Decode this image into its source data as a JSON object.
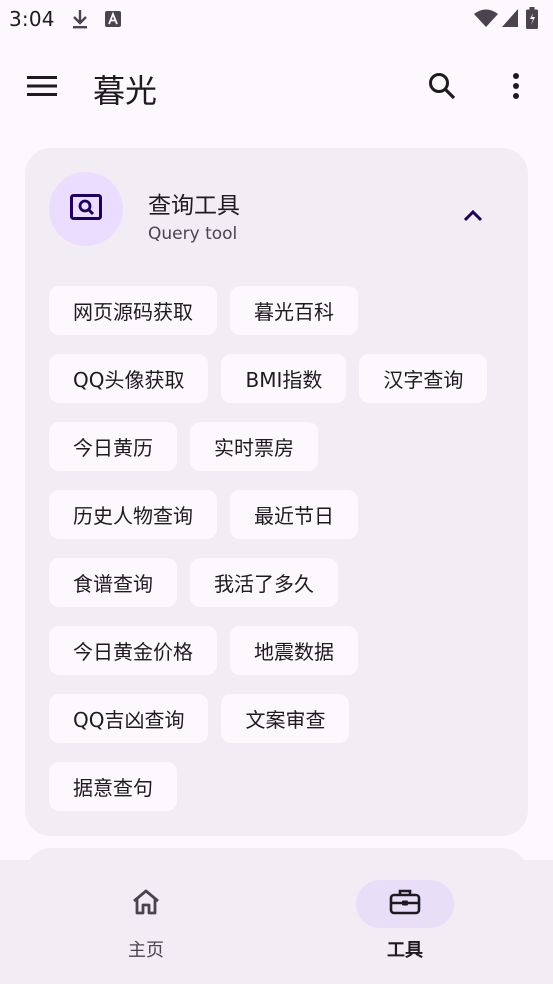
{
  "status_bar": {
    "time": "3:04",
    "left_icons": [
      "download-icon",
      "text-badge-icon"
    ],
    "right_icons": [
      "wifi-icon",
      "cellular-icon",
      "battery-icon"
    ]
  },
  "app_bar": {
    "title": "暮光",
    "icons": [
      "menu-icon",
      "search-icon",
      "more-vert-icon"
    ]
  },
  "card": {
    "title": "查询工具",
    "subtitle": "Query tool",
    "icon": "image-search-icon",
    "toggle_icon": "chevron-up-icon",
    "chips": [
      "网页源码获取",
      "暮光百科",
      "QQ头像获取",
      "BMI指数",
      "汉字查询",
      "今日黄历",
      "实时票房",
      "历史人物查询",
      "最近节日",
      "食谱查询",
      "我活了多久",
      "今日黄金价格",
      "地震数据",
      "QQ吉凶查询",
      "文案审查",
      "据意查句"
    ]
  },
  "bottom_nav": {
    "items": [
      {
        "label": "主页",
        "icon": "home-icon",
        "selected": false
      },
      {
        "label": "工具",
        "icon": "toolbox-icon",
        "selected": true
      }
    ]
  },
  "colors": {
    "background": "#fdf8fd",
    "surface_container": "#f2ecf4",
    "primary_container": "#eaddff",
    "secondary_container": "#e8def8",
    "on_surface": "#1d1b20",
    "primary_dark": "#21005d"
  }
}
